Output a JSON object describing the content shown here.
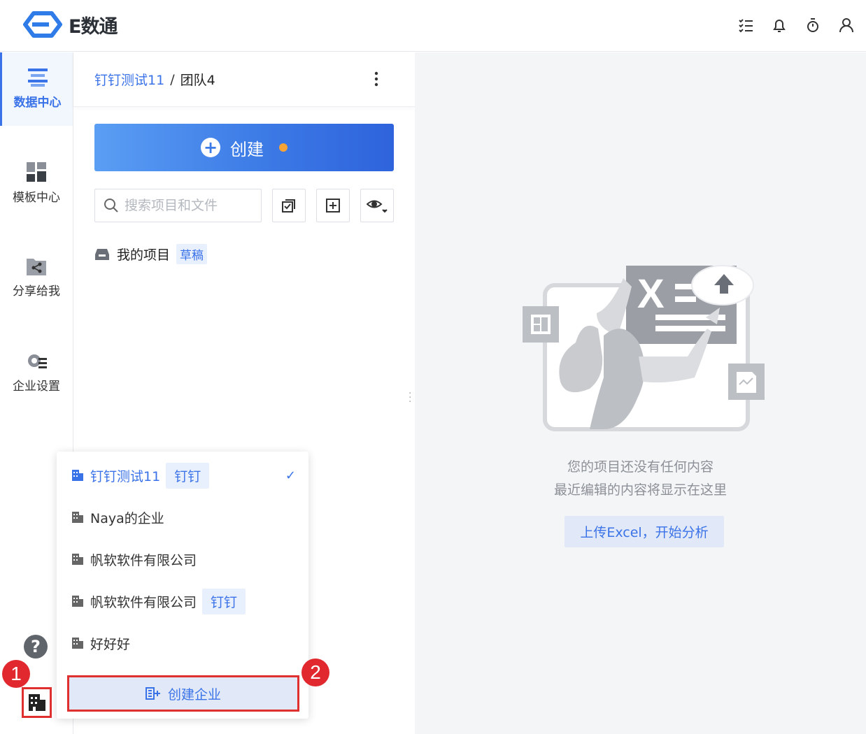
{
  "app": {
    "logo_text": "E数通",
    "brand_color": "#3a72e8"
  },
  "topbar": {
    "icons": [
      "task-list-icon",
      "bell-icon",
      "timer-icon",
      "user-icon"
    ]
  },
  "leftnav": {
    "items": [
      {
        "label": "数据中心",
        "icon": "data-center-icon",
        "active": true
      },
      {
        "label": "模板中心",
        "icon": "template-icon",
        "active": false
      },
      {
        "label": "分享给我",
        "icon": "share-icon",
        "active": false
      },
      {
        "label": "企业设置",
        "icon": "enterprise-settings-icon",
        "active": false
      }
    ]
  },
  "panel": {
    "breadcrumb": {
      "org": "钉钉测试11",
      "sep": "/",
      "team": "团队4"
    },
    "create_label": "创建",
    "search_placeholder": "搜索项目和文件",
    "project": {
      "label": "我的项目",
      "tag": "草稿"
    }
  },
  "main": {
    "empty_line1": "您的项目还没有任何内容",
    "empty_line2": "最近编辑的内容将显示在这里",
    "upload_label": "上传Excel，开始分析"
  },
  "enterprise_menu": {
    "items": [
      {
        "label": "钉钉测试11",
        "tag": "钉钉",
        "selected": true
      },
      {
        "label": "Naya的企业",
        "tag": "",
        "selected": false
      },
      {
        "label": "帆软软件有限公司",
        "tag": "",
        "selected": false
      },
      {
        "label": "帆软软件有限公司",
        "tag": "钉钉",
        "selected": false
      },
      {
        "label": "好好好",
        "tag": "",
        "selected": false
      }
    ],
    "check_mark": "✓",
    "create_label": "创建企业"
  },
  "help_label": "?",
  "annotations": {
    "badge1": "1",
    "badge2": "2"
  }
}
